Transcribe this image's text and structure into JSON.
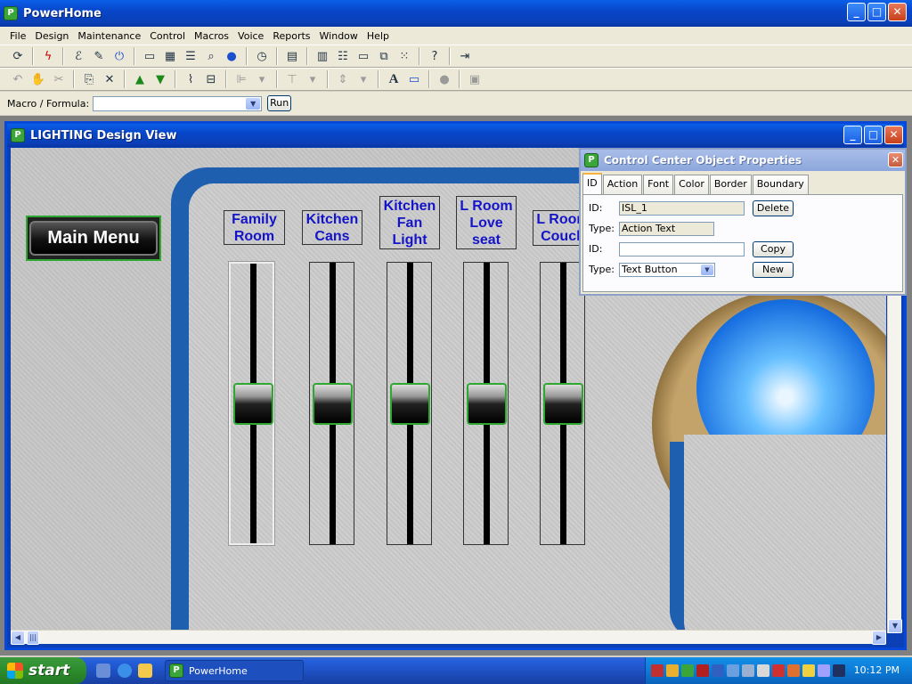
{
  "app": {
    "title": "PowerHome"
  },
  "menu": [
    "File",
    "Design",
    "Maintenance",
    "Control",
    "Macros",
    "Voice",
    "Reports",
    "Window",
    "Help"
  ],
  "macrobar": {
    "label": "Macro / Formula:",
    "value": "",
    "run_label": "Run"
  },
  "child_window": {
    "title": "LIGHTING Design View"
  },
  "main_menu_button": {
    "label": "Main Menu"
  },
  "sliders": [
    {
      "label": "Family\nRoom",
      "level": 0.5
    },
    {
      "label": "Kitchen\nCans",
      "level": 0.5
    },
    {
      "label": "Kitchen\nFan\nLight",
      "level": 0.5
    },
    {
      "label": "L Room\nLove\nseat",
      "level": 0.5
    },
    {
      "label": "L Room\nCouch",
      "level": 0.5
    }
  ],
  "properties": {
    "title": "Control Center Object Properties",
    "tabs": [
      "ID",
      "Action",
      "Font",
      "Color",
      "Border",
      "Boundary"
    ],
    "active_tab": "ID",
    "id_label": "ID:",
    "id_value": "ISL_1",
    "type_label": "Type:",
    "type_value": "Action Text",
    "new_id_label": "ID:",
    "new_id_value": "",
    "new_type_label": "Type:",
    "new_type_value": "Text Button",
    "delete_label": "Delete",
    "copy_label": "Copy",
    "new_label": "New"
  },
  "taskbar": {
    "start_label": "start",
    "task_label": "PowerHome",
    "clock": "10:12 PM"
  }
}
